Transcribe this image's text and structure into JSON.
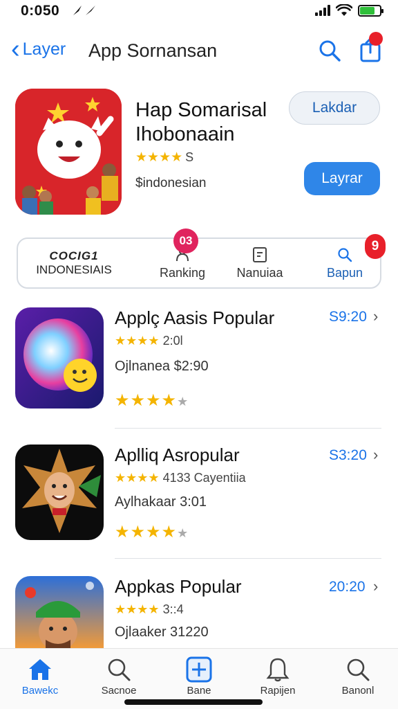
{
  "status_bar": {
    "time": "0:050"
  },
  "nav": {
    "back_label": "Layer",
    "title": "App Sornansan"
  },
  "hero": {
    "name_line1": "Hap Somarisal",
    "name_line2": "Ihobonaain",
    "stars": "★★★★",
    "rating_count": "S",
    "subtitle": "$indonesian",
    "btn_outline_label": "Lakdar",
    "btn_solid_label": "Layrar"
  },
  "categories": {
    "item1_line1": "COCIG1",
    "item1_line2": "INDONESIAIS",
    "item2_label": "Ranking",
    "item2_badge": "03",
    "item3_label": "Nanuiaa",
    "item4_label": "Bapun",
    "item4_badge": "9"
  },
  "apps": [
    {
      "title": "Applç Aasis Popular",
      "stars": "★★★★",
      "rating": "2:0l",
      "meta": "Ojlnanea $2:90",
      "stars2": "★★★★",
      "price": "S9:20"
    },
    {
      "title": "Aplliq Asropular",
      "stars": "★★★★",
      "rating": "4133 Cayentiia",
      "meta": "Aylhakaar 3:01",
      "stars2": "★★★★",
      "price": "S3:20"
    },
    {
      "title": "Appkas Popular",
      "stars": "★★★★",
      "rating": "3::4",
      "meta": "Ojlaaker 31220",
      "stars2": "",
      "price": "20:20"
    }
  ],
  "tabs": [
    {
      "label": "Bawekc"
    },
    {
      "label": "Sacnoe"
    },
    {
      "label": "Bane"
    },
    {
      "label": "Rapijen"
    },
    {
      "label": "Banonl"
    }
  ],
  "colors": {
    "accent": "#1a73e8",
    "badge": "#e8202a",
    "star": "#f4b400"
  }
}
